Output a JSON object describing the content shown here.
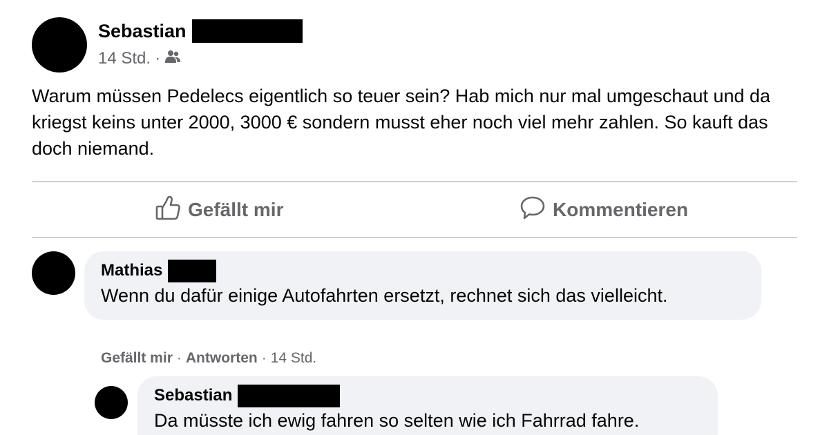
{
  "post": {
    "author": "Sebastian",
    "time": "14 Std.",
    "separator": "·",
    "audience_icon": "friends-icon",
    "text": "Warum müssen Pedelecs eigentlich so teuer sein? Hab mich nur mal umgeschaut und da kriegst keins unter 2000, 3000 € sondern musst eher noch viel mehr zahlen. So kauft das doch niemand."
  },
  "actions": {
    "like_label": "Gefällt mir",
    "like_icon": "thumbs-up-icon",
    "comment_label": "Kommentieren",
    "comment_icon": "speech-bubble-icon"
  },
  "comments": [
    {
      "author": "Mathias",
      "text": "Wenn du dafür einige Autofahrten ersetzt, rechnet sich das vielleicht.",
      "like_label": "Gefällt mir",
      "reply_label": "Antworten",
      "time": "14 Std.",
      "separator": "·"
    },
    {
      "author": "Sebastian",
      "text": "Da müsste ich ewig fahren so selten wie ich Fahrrad fahre."
    }
  ],
  "colors": {
    "text": "#050505",
    "secondary": "#65676b",
    "bubble": "#f0f2f5",
    "divider": "#ced0d4",
    "redaction": "#000000"
  }
}
